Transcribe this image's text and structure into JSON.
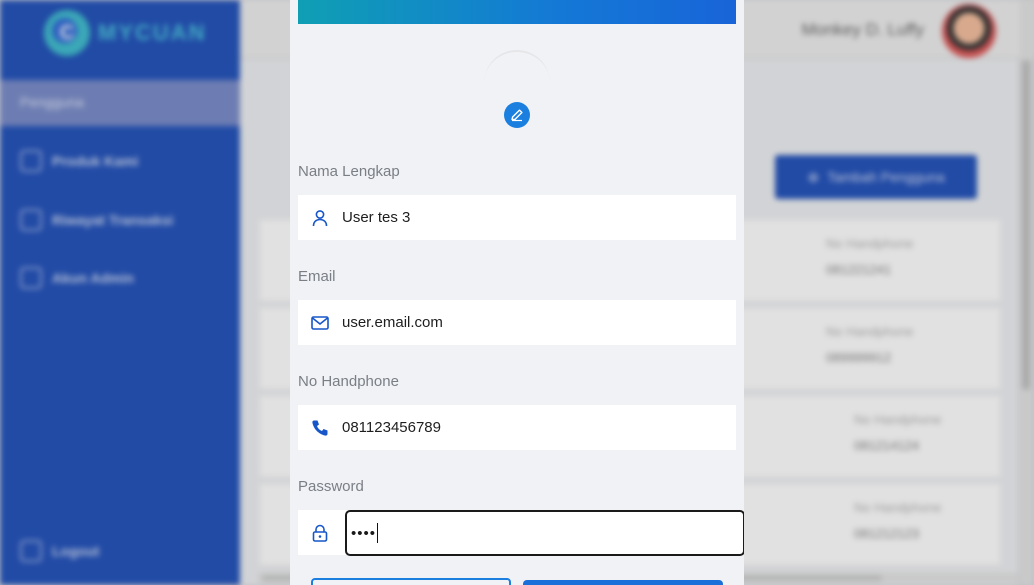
{
  "app": {
    "logo_text": "MYCUAN",
    "user_name": "Monkey D. Luffy"
  },
  "sidebar": {
    "active_label": "Pengguna",
    "items": [
      {
        "label": "Produk Kami",
        "icon": "box-icon"
      },
      {
        "label": "Riwayat Transaksi",
        "icon": "history-icon"
      },
      {
        "label": "Akun Admin",
        "icon": "admin-icon"
      }
    ],
    "logout_label": "Logout"
  },
  "page": {
    "add_button_label": "Tambah Pengguna",
    "rows": [
      {
        "label": "No Handphone",
        "value": "081221241"
      },
      {
        "label": "No Handphone",
        "value": "089999912"
      },
      {
        "label": "No Handphone",
        "value": "081214124"
      },
      {
        "label": "No Handphone",
        "value": "081212123"
      }
    ]
  },
  "modal": {
    "fields": [
      {
        "label": "Nama Lengkap",
        "value": "User tes 3",
        "icon": "user-icon"
      },
      {
        "label": "Email",
        "value": "user.email.com",
        "icon": "mail-icon"
      },
      {
        "label": "No Handphone",
        "value": "081123456789",
        "icon": "phone-icon"
      }
    ],
    "password": {
      "label": "Password",
      "value": "••••",
      "icon": "lock-icon"
    }
  },
  "colors": {
    "sidebar": "#0a3fb3",
    "accent": "#1b7fe0",
    "modal_bg": "#f1f2f6"
  }
}
